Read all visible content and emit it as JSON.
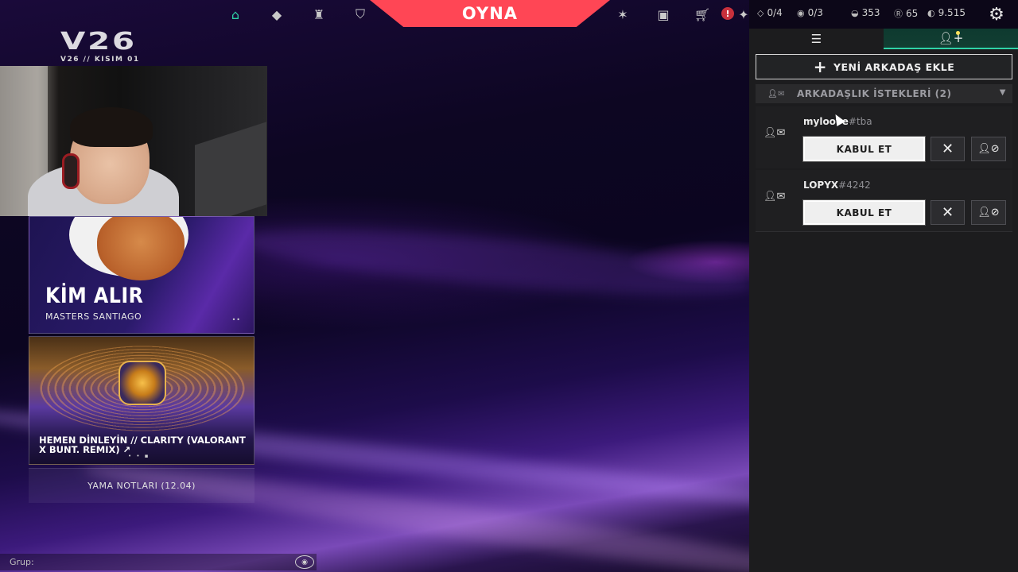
{
  "topbar": {
    "play_label": "OYNA",
    "nav_icons": [
      "home-icon",
      "agents-icon",
      "career-icon",
      "battlepass-icon"
    ],
    "right_icons": [
      "collection-icon",
      "locker-icon",
      "store-icon"
    ],
    "alert_badge": "!",
    "daily_progress": "0/4",
    "weekly_progress": "0/3",
    "radianite_points": "353",
    "kingdom_credits": "65",
    "valorant_points": "9.515",
    "accent_color": "#ff4655",
    "home_color": "#2fd3a7"
  },
  "season": {
    "logo": "V26",
    "subtitle": "V26 // KISIM 01"
  },
  "cards": {
    "card1": {
      "title": "KİM ALIR",
      "subtitle": "MASTERS SANTIAGO",
      "pager": "••"
    },
    "card2": {
      "title": "HEMEN DİNLEYİN // CLARITY (VALORANT X BUNT. REMIX)",
      "external_icon": "↗",
      "pager": "• • ▪"
    },
    "patch_notes": "YAMA NOTLARI (12.04)"
  },
  "group": {
    "label": "Grup:"
  },
  "social": {
    "add_friend_label": "YENİ ARKADAŞ EKLE",
    "requests_header": "ARKADAŞLIK İSTEKLERİ (2)",
    "requests": [
      {
        "name": "myloove",
        "tag": "#tba",
        "accept_label": "KABUL ET"
      },
      {
        "name": "LOPYX",
        "tag": "#4242",
        "accept_label": "KABUL ET"
      }
    ]
  }
}
